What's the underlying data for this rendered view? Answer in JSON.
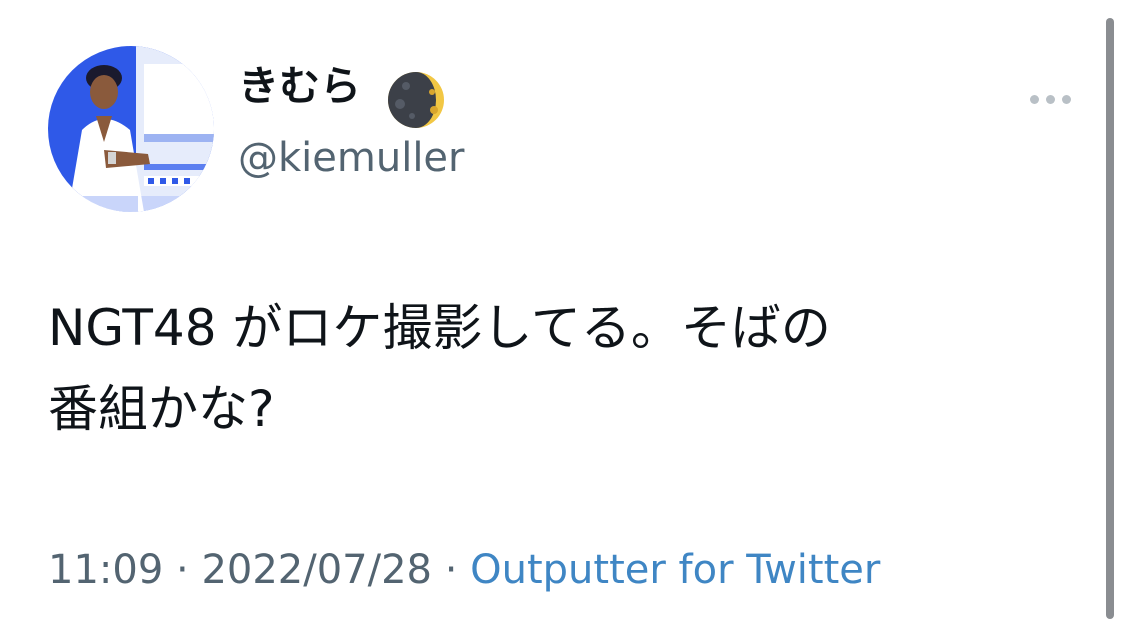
{
  "tweet": {
    "display_name": "きむら",
    "name_emoji_icon": "waning-crescent-moon-icon",
    "handle": "@kiemuller",
    "text_line1": "NGT48 がロケ撮影してる。そばの",
    "text_line2": "番組かな?",
    "time": "11:09",
    "separator": " · ",
    "date": "2022/07/28",
    "source": "Outputter for Twitter"
  },
  "colors": {
    "text_primary": "#0f1419",
    "text_secondary": "#536471",
    "link": "#3f86c4",
    "avatar_bg": "#2f59e8"
  }
}
